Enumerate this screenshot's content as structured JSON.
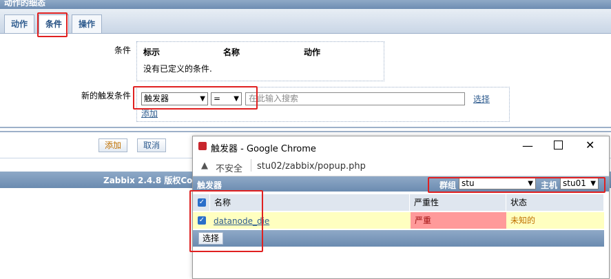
{
  "page": {
    "title": "动作的细态"
  },
  "tabs": [
    {
      "label": "动作"
    },
    {
      "label": "条件"
    },
    {
      "label": "操作"
    }
  ],
  "conditions": {
    "label": "条件",
    "columns": [
      "标示",
      "名称",
      "动作"
    ],
    "empty_text": "没有已定义的条件."
  },
  "new_trigger": {
    "label": "新的触发条件",
    "type_value": "触发器",
    "operator_value": "=",
    "search_placeholder": "在此输入搜索",
    "select_link": "选择",
    "add_link": "添加"
  },
  "buttons": {
    "add": "添加",
    "cancel": "取消"
  },
  "footer": {
    "text": "Zabbix 2.4.8 版权Co"
  },
  "popup": {
    "title": "触发器 - Google Chrome",
    "insecure_label": "不安全",
    "url": "stu02/zabbix/popup.php",
    "header_title": "触发器",
    "group_label": "群组",
    "group_value": "stu",
    "host_label": "主机",
    "host_value": "stu01",
    "columns": [
      "名称",
      "严重性",
      "状态"
    ],
    "rows": [
      {
        "name": "datanode_die",
        "severity": "严重",
        "status": "未知的",
        "checked": true
      }
    ],
    "select_button": "选择"
  },
  "colors": {
    "accent": "#2f5c8f",
    "highlight": "#e02020",
    "severity_bg": "#ff9a9a",
    "row_bg": "#ffffc0"
  }
}
